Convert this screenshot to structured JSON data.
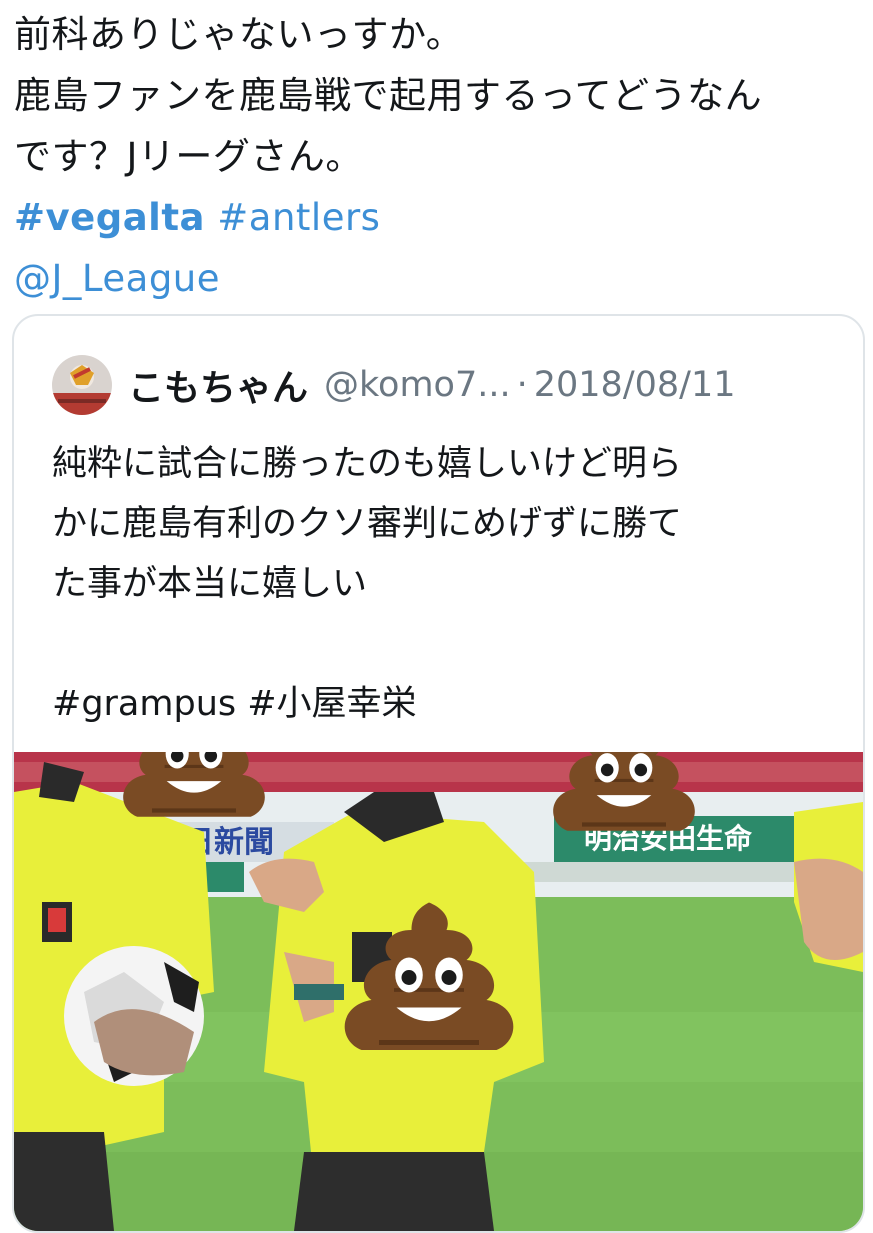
{
  "tweet": {
    "line1": "前科ありじゃないっすか。",
    "line2": "鹿島ファンを鹿島戦で起用するってどうなん",
    "line3": "です？Jリーグさん。",
    "hashtag_bold": "#vegalta",
    "hashtag2": "#antlers",
    "mention": "@J_League"
  },
  "quoted": {
    "display_name": "こもちゃん",
    "handle": "@komo7...",
    "separator": "·",
    "date": "2018/08/11",
    "lines": [
      "純粋に試合に勝ったのも嬉しいけど明ら",
      "かに鹿島有利のクソ審判にめげずに勝て",
      "た事が本当に嬉しい",
      "",
      "#grampus #小屋幸栄"
    ],
    "photo": {
      "ad_board_1": "朝日新聞",
      "ad_board_2": "明治安田生命",
      "ad_board_small": "命"
    }
  },
  "colors": {
    "link": "#3d8fd6",
    "muted": "#6b7782",
    "border": "#dfe4e8",
    "ref_shirt": "#e8ef3a",
    "pitch": "#7cbd5a"
  },
  "icons": [
    "avatar",
    "poop-emoji"
  ]
}
